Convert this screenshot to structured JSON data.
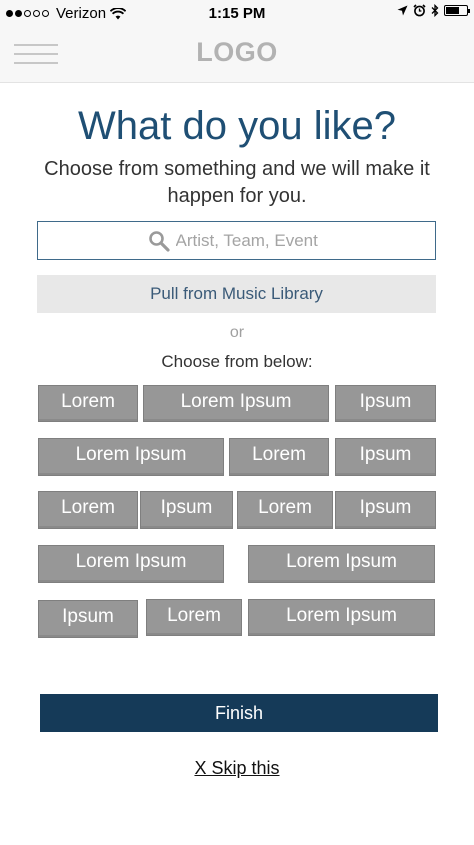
{
  "status_bar": {
    "carrier": "Verizon",
    "time": "1:15 PM",
    "signal_dots": 5,
    "signal_filled": 2,
    "icons": [
      "wifi-icon",
      "location-arrow-icon",
      "alarm-icon",
      "bluetooth-icon",
      "battery-icon"
    ]
  },
  "nav": {
    "logo": "LOGO",
    "menu_icon": "hamburger-menu-icon"
  },
  "main": {
    "title": "What do you like?",
    "subtitle": "Choose from something and we will make it happen for you.",
    "search": {
      "placeholder": "Artist, Team, Event",
      "value": "",
      "icon": "search-icon"
    },
    "pull_button": "Pull from Music Library",
    "or_text": "or",
    "choose_text": "Choose from below:",
    "tags": [
      [
        "Lorem",
        "Lorem Ipsum",
        "Ipsum"
      ],
      [
        "Lorem Ipsum",
        "Lorem",
        "Ipsum"
      ],
      [
        "Lorem",
        "Ipsum",
        "Lorem",
        "Ipsum"
      ],
      [
        "Lorem Ipsum",
        "Lorem Ipsum"
      ],
      [
        "Ipsum",
        "Lorem",
        "Lorem Ipsum"
      ]
    ],
    "finish_button": "Finish",
    "skip_link": "X Skip this"
  },
  "colors": {
    "title": "#1f4f74",
    "finish_bg": "#153a58",
    "tag_bg": "#979797",
    "search_border": "#3f6a8a"
  }
}
